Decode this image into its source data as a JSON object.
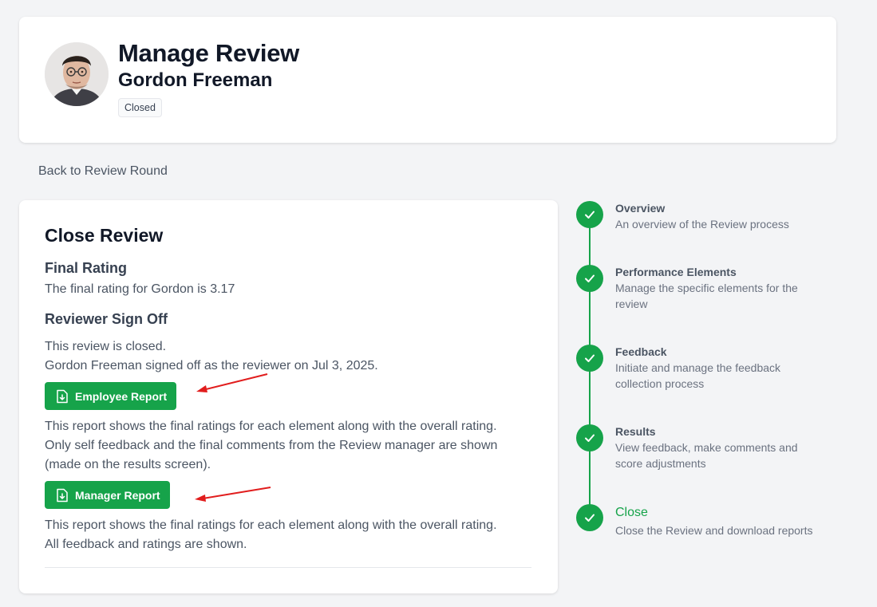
{
  "header": {
    "title": "Manage Review",
    "subtitle": "Gordon Freeman",
    "status_badge": "Closed"
  },
  "nav": {
    "back_label": "Back to Review Round"
  },
  "main": {
    "heading": "Close Review",
    "final_rating_heading": "Final Rating",
    "final_rating_text": "The final rating for Gordon is 3.17",
    "signoff_heading": "Reviewer Sign Off",
    "signoff_line1": "This review is closed.",
    "signoff_line2": "Gordon Freeman signed off as the reviewer on Jul 3, 2025.",
    "employee_report": {
      "label": "Employee Report",
      "desc_lines": [
        "This report shows the final ratings for each element along with the overall rating.",
        "Only self feedback and the final comments from the Review manager are shown",
        "(made on the results screen)."
      ]
    },
    "manager_report": {
      "label": "Manager Report",
      "desc_lines": [
        "This report shows the final ratings for each element along with the overall rating.",
        "All feedback and ratings are shown."
      ]
    }
  },
  "steps": [
    {
      "title": "Overview",
      "desc": "An overview of the Review process",
      "complete": true
    },
    {
      "title": "Performance Elements",
      "desc": "Manage the specific elements for the review",
      "complete": true
    },
    {
      "title": "Feedback",
      "desc": "Initiate and manage the feedback collection process",
      "complete": true
    },
    {
      "title": "Results",
      "desc": "View feedback, make comments and score adjustments",
      "complete": true
    },
    {
      "title": "Close",
      "desc": "Close the Review and download reports",
      "complete": true,
      "active": true
    }
  ],
  "colors": {
    "accent": "#16a34a",
    "annotation_arrow": "#e11d1d"
  }
}
